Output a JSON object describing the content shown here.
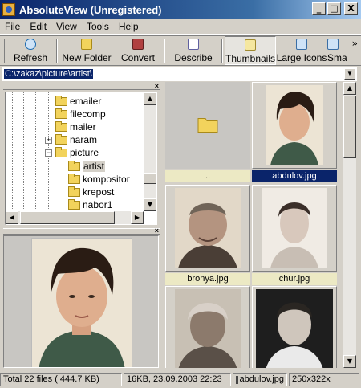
{
  "window": {
    "title": "AbsoluteView (Unregistered)",
    "minimize": "_",
    "maximize": "□",
    "close": "X"
  },
  "menu": [
    "File",
    "Edit",
    "View",
    "Tools",
    "Help"
  ],
  "toolbar": {
    "refresh": "Refresh",
    "new_folder": "New Folder",
    "convert": "Convert",
    "describe": "Describe",
    "thumbnails": "Thumbnails",
    "large_icons": "Large Icons",
    "small": "Sma",
    "more": "»"
  },
  "path": {
    "value": "C:\\zakaz\\picture\\artist\\"
  },
  "tree": {
    "items": [
      "emailer",
      "filecomp",
      "mailer",
      "naram",
      "picture",
      "artist",
      "kompositor",
      "krepost",
      "nabor1"
    ],
    "expander_plus": "+",
    "expander_minus": "−"
  },
  "thumbnails": {
    "items": [
      {
        "label": "..",
        "icon": "folder-icon"
      },
      {
        "label": "abdulov.jpg",
        "selected": true
      },
      {
        "label": "bronya.jpg"
      },
      {
        "label": "chur.jpg"
      },
      {
        "label": ""
      },
      {
        "label": ""
      }
    ]
  },
  "status": {
    "total": "Total 22 files ( 444.7 KB)",
    "fileinfo": "16KB, 23.09.2003 22:23",
    "filename": "abdulov.jpg",
    "dimensions": "250x322x"
  },
  "colors": {
    "titlebar": "#0a246a",
    "selection": "#0a246a",
    "label_bg": "#ece9c4",
    "face": "#d4d0c8"
  }
}
